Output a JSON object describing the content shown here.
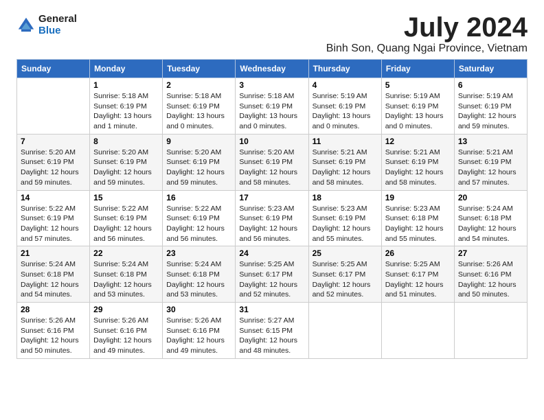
{
  "header": {
    "logo_line1": "General",
    "logo_line2": "Blue",
    "month_title": "July 2024",
    "location": "Binh Son, Quang Ngai Province, Vietnam"
  },
  "weekdays": [
    "Sunday",
    "Monday",
    "Tuesday",
    "Wednesday",
    "Thursday",
    "Friday",
    "Saturday"
  ],
  "weeks": [
    {
      "shaded": false,
      "days": [
        {
          "num": "",
          "info": ""
        },
        {
          "num": "1",
          "info": "Sunrise: 5:18 AM\nSunset: 6:19 PM\nDaylight: 13 hours\nand 1 minute."
        },
        {
          "num": "2",
          "info": "Sunrise: 5:18 AM\nSunset: 6:19 PM\nDaylight: 13 hours\nand 0 minutes."
        },
        {
          "num": "3",
          "info": "Sunrise: 5:18 AM\nSunset: 6:19 PM\nDaylight: 13 hours\nand 0 minutes."
        },
        {
          "num": "4",
          "info": "Sunrise: 5:19 AM\nSunset: 6:19 PM\nDaylight: 13 hours\nand 0 minutes."
        },
        {
          "num": "5",
          "info": "Sunrise: 5:19 AM\nSunset: 6:19 PM\nDaylight: 13 hours\nand 0 minutes."
        },
        {
          "num": "6",
          "info": "Sunrise: 5:19 AM\nSunset: 6:19 PM\nDaylight: 12 hours\nand 59 minutes."
        }
      ]
    },
    {
      "shaded": true,
      "days": [
        {
          "num": "7",
          "info": "Sunrise: 5:20 AM\nSunset: 6:19 PM\nDaylight: 12 hours\nand 59 minutes."
        },
        {
          "num": "8",
          "info": "Sunrise: 5:20 AM\nSunset: 6:19 PM\nDaylight: 12 hours\nand 59 minutes."
        },
        {
          "num": "9",
          "info": "Sunrise: 5:20 AM\nSunset: 6:19 PM\nDaylight: 12 hours\nand 59 minutes."
        },
        {
          "num": "10",
          "info": "Sunrise: 5:20 AM\nSunset: 6:19 PM\nDaylight: 12 hours\nand 58 minutes."
        },
        {
          "num": "11",
          "info": "Sunrise: 5:21 AM\nSunset: 6:19 PM\nDaylight: 12 hours\nand 58 minutes."
        },
        {
          "num": "12",
          "info": "Sunrise: 5:21 AM\nSunset: 6:19 PM\nDaylight: 12 hours\nand 58 minutes."
        },
        {
          "num": "13",
          "info": "Sunrise: 5:21 AM\nSunset: 6:19 PM\nDaylight: 12 hours\nand 57 minutes."
        }
      ]
    },
    {
      "shaded": false,
      "days": [
        {
          "num": "14",
          "info": "Sunrise: 5:22 AM\nSunset: 6:19 PM\nDaylight: 12 hours\nand 57 minutes."
        },
        {
          "num": "15",
          "info": "Sunrise: 5:22 AM\nSunset: 6:19 PM\nDaylight: 12 hours\nand 56 minutes."
        },
        {
          "num": "16",
          "info": "Sunrise: 5:22 AM\nSunset: 6:19 PM\nDaylight: 12 hours\nand 56 minutes."
        },
        {
          "num": "17",
          "info": "Sunrise: 5:23 AM\nSunset: 6:19 PM\nDaylight: 12 hours\nand 56 minutes."
        },
        {
          "num": "18",
          "info": "Sunrise: 5:23 AM\nSunset: 6:19 PM\nDaylight: 12 hours\nand 55 minutes."
        },
        {
          "num": "19",
          "info": "Sunrise: 5:23 AM\nSunset: 6:18 PM\nDaylight: 12 hours\nand 55 minutes."
        },
        {
          "num": "20",
          "info": "Sunrise: 5:24 AM\nSunset: 6:18 PM\nDaylight: 12 hours\nand 54 minutes."
        }
      ]
    },
    {
      "shaded": true,
      "days": [
        {
          "num": "21",
          "info": "Sunrise: 5:24 AM\nSunset: 6:18 PM\nDaylight: 12 hours\nand 54 minutes."
        },
        {
          "num": "22",
          "info": "Sunrise: 5:24 AM\nSunset: 6:18 PM\nDaylight: 12 hours\nand 53 minutes."
        },
        {
          "num": "23",
          "info": "Sunrise: 5:24 AM\nSunset: 6:18 PM\nDaylight: 12 hours\nand 53 minutes."
        },
        {
          "num": "24",
          "info": "Sunrise: 5:25 AM\nSunset: 6:17 PM\nDaylight: 12 hours\nand 52 minutes."
        },
        {
          "num": "25",
          "info": "Sunrise: 5:25 AM\nSunset: 6:17 PM\nDaylight: 12 hours\nand 52 minutes."
        },
        {
          "num": "26",
          "info": "Sunrise: 5:25 AM\nSunset: 6:17 PM\nDaylight: 12 hours\nand 51 minutes."
        },
        {
          "num": "27",
          "info": "Sunrise: 5:26 AM\nSunset: 6:16 PM\nDaylight: 12 hours\nand 50 minutes."
        }
      ]
    },
    {
      "shaded": false,
      "days": [
        {
          "num": "28",
          "info": "Sunrise: 5:26 AM\nSunset: 6:16 PM\nDaylight: 12 hours\nand 50 minutes."
        },
        {
          "num": "29",
          "info": "Sunrise: 5:26 AM\nSunset: 6:16 PM\nDaylight: 12 hours\nand 49 minutes."
        },
        {
          "num": "30",
          "info": "Sunrise: 5:26 AM\nSunset: 6:16 PM\nDaylight: 12 hours\nand 49 minutes."
        },
        {
          "num": "31",
          "info": "Sunrise: 5:27 AM\nSunset: 6:15 PM\nDaylight: 12 hours\nand 48 minutes."
        },
        {
          "num": "",
          "info": ""
        },
        {
          "num": "",
          "info": ""
        },
        {
          "num": "",
          "info": ""
        }
      ]
    }
  ]
}
